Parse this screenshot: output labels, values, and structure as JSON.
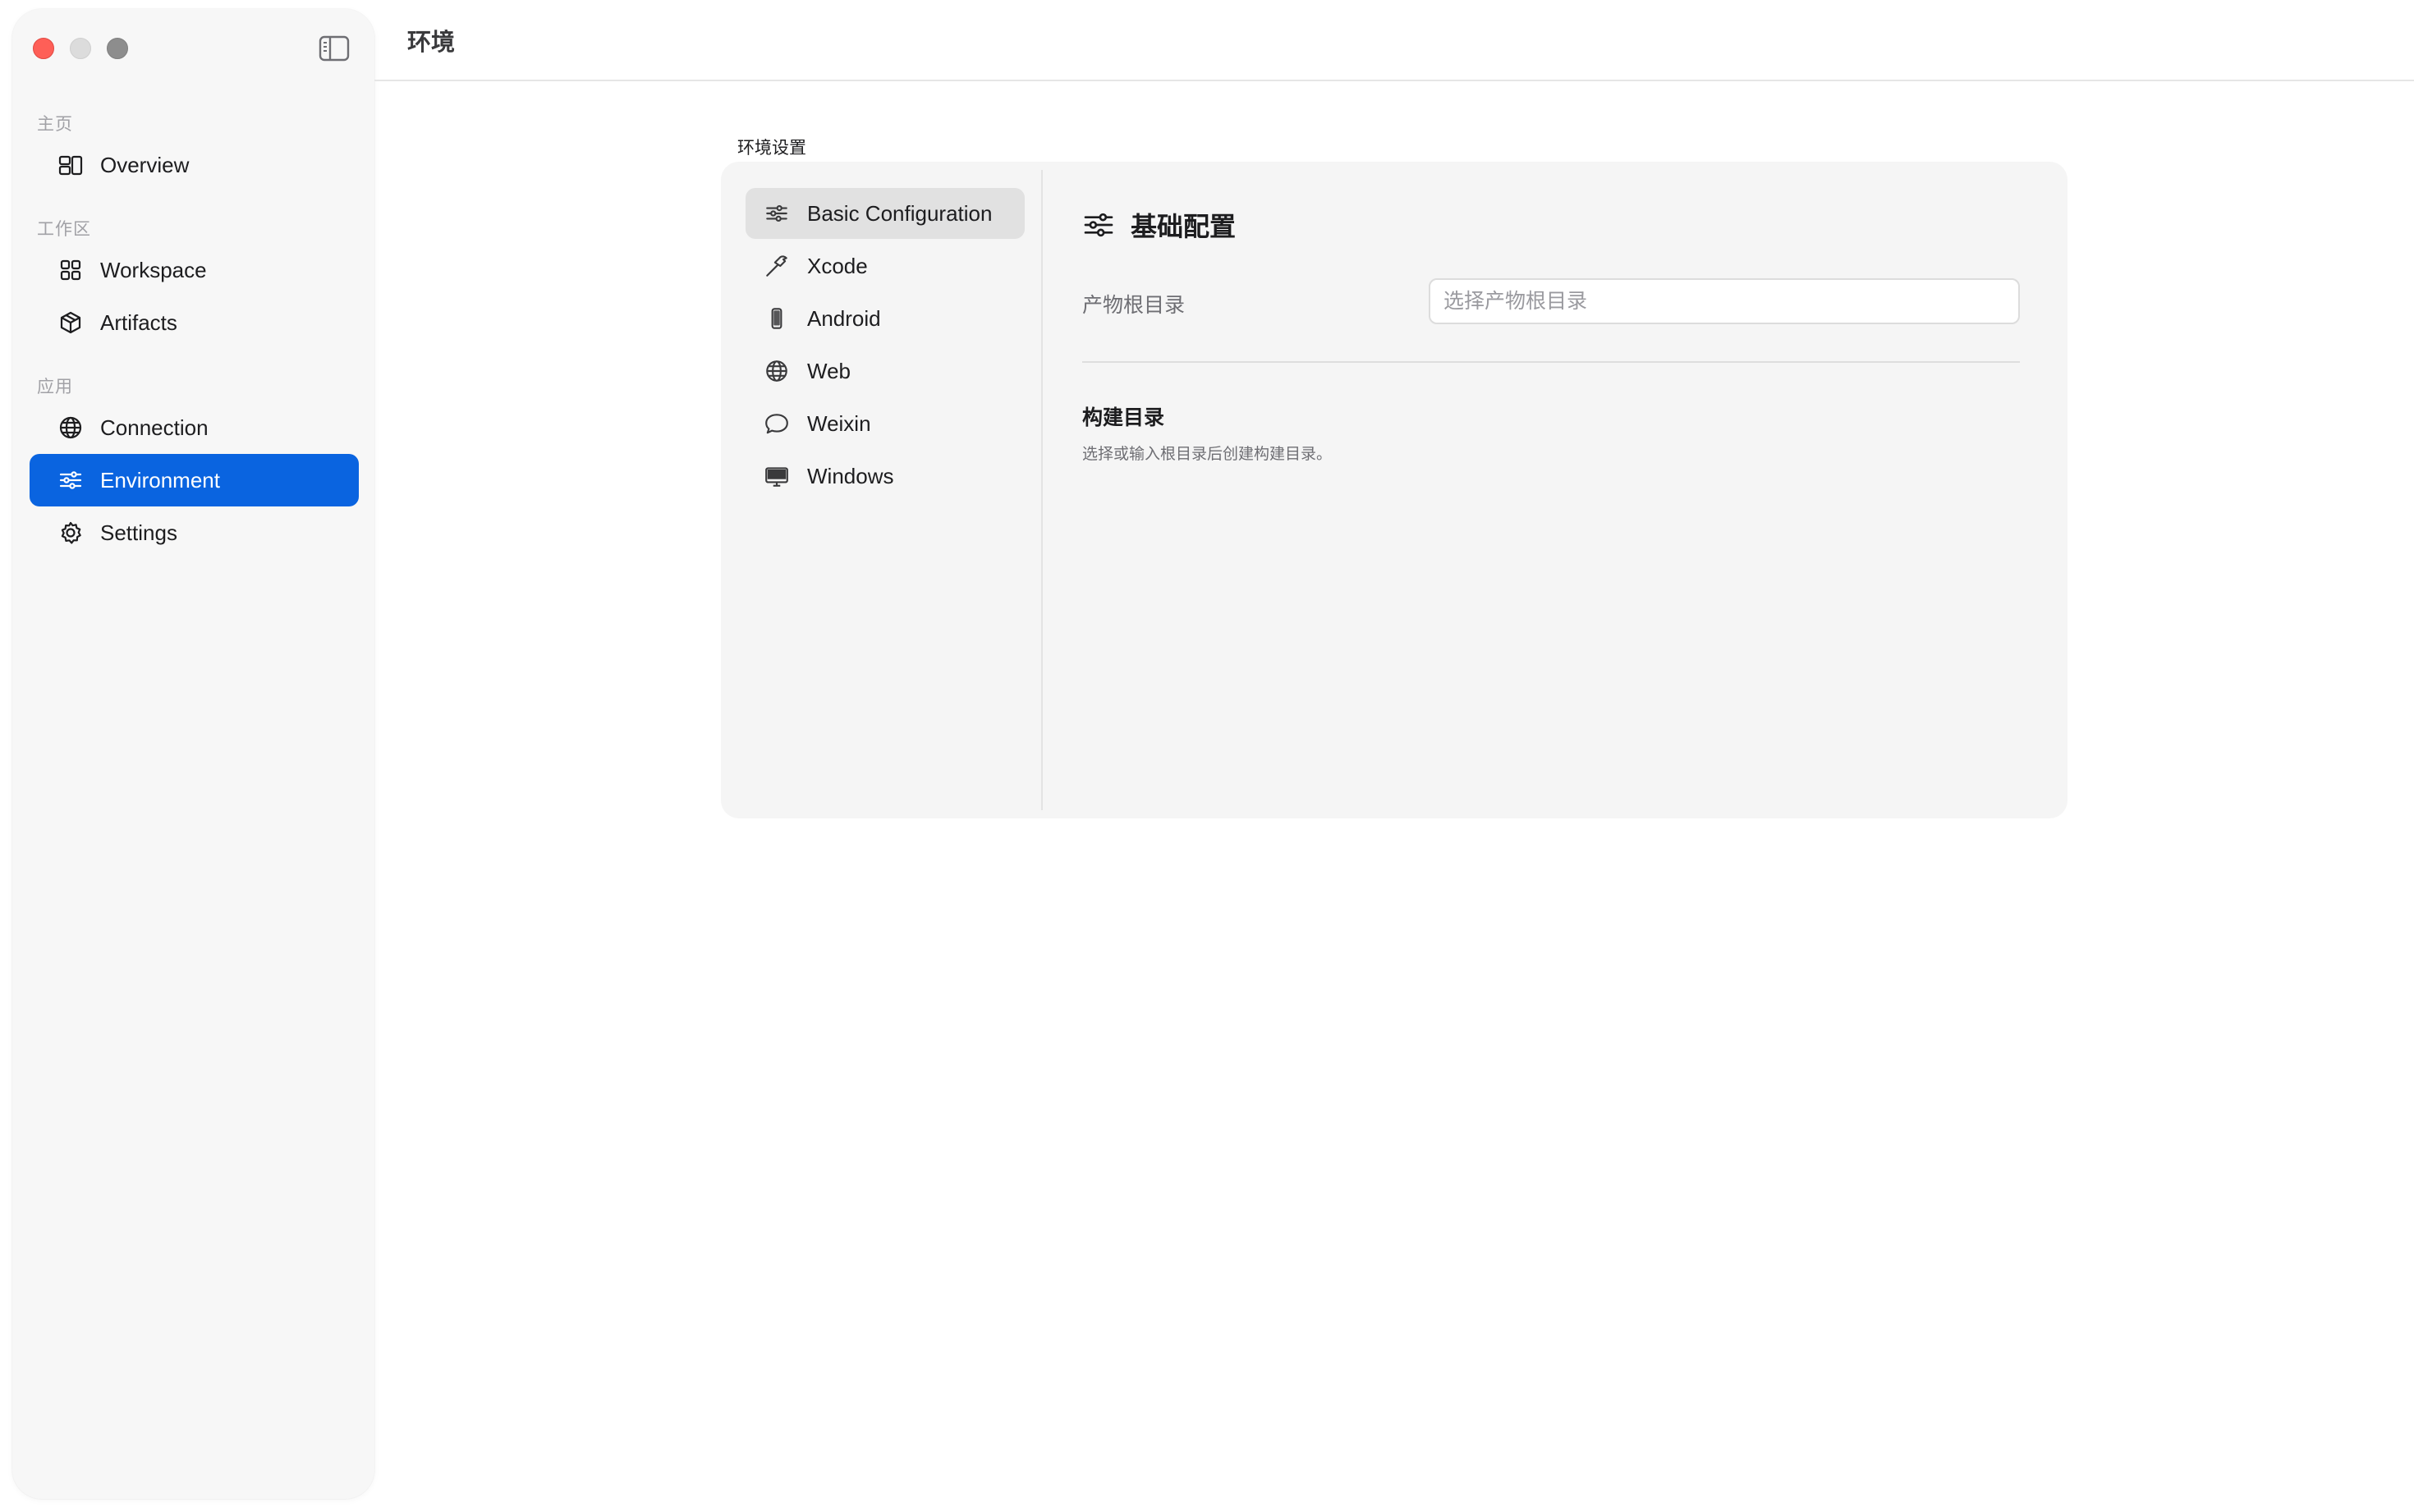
{
  "window": {
    "title": "环境"
  },
  "sidebar": {
    "sections": [
      {
        "label": "主页"
      },
      {
        "label": "工作区"
      },
      {
        "label": "应用"
      }
    ],
    "items": [
      {
        "label": "Overview",
        "icon": "overview-icon"
      },
      {
        "label": "Workspace",
        "icon": "grid-icon"
      },
      {
        "label": "Artifacts",
        "icon": "cube-icon"
      },
      {
        "label": "Connection",
        "icon": "globe-network-icon"
      },
      {
        "label": "Environment",
        "icon": "sliders-icon",
        "active": true
      },
      {
        "label": "Settings",
        "icon": "gear-icon"
      }
    ],
    "active_color": "#0a64e0"
  },
  "main": {
    "panel_caption": "环境设置",
    "env_nav": [
      {
        "label": "Basic Configuration",
        "icon": "sliders-icon",
        "active": true
      },
      {
        "label": "Xcode",
        "icon": "hammer-icon"
      },
      {
        "label": "Android",
        "icon": "phone-icon"
      },
      {
        "label": "Web",
        "icon": "globe-icon"
      },
      {
        "label": "Weixin",
        "icon": "chat-bubble-icon"
      },
      {
        "label": "Windows",
        "icon": "monitor-icon"
      }
    ],
    "content": {
      "title": "基础配置",
      "artifact_root": {
        "label": "产物根目录",
        "placeholder": "选择产物根目录",
        "value": ""
      },
      "build_dir": {
        "title": "构建目录",
        "description": "选择或输入根目录后创建构建目录。"
      }
    }
  }
}
